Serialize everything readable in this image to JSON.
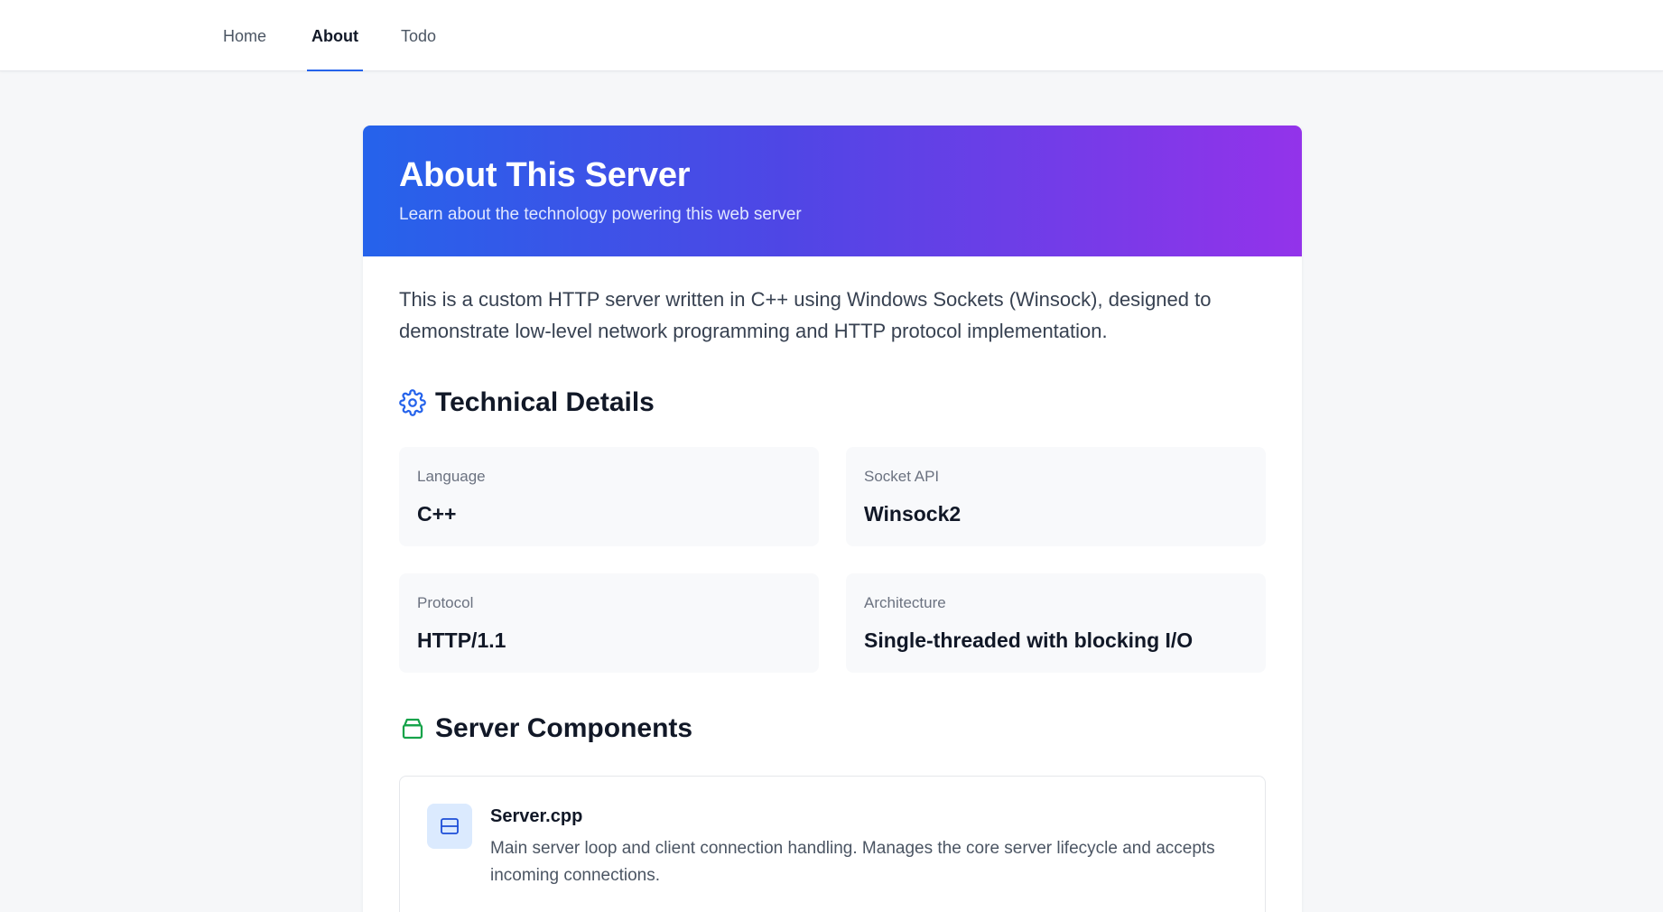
{
  "nav": {
    "home": "Home",
    "about": "About",
    "todo": "Todo"
  },
  "hero": {
    "title": "About This Server",
    "subtitle": "Learn about the technology powering this web server"
  },
  "intro": "This is a custom HTTP server written in C++ using Windows Sockets (Winsock), designed to demonstrate low-level network programming and HTTP protocol implementation.",
  "technical": {
    "heading": "Technical Details",
    "icon": "gear-icon",
    "items": [
      {
        "label": "Language",
        "value": "C++"
      },
      {
        "label": "Socket API",
        "value": "Winsock2"
      },
      {
        "label": "Protocol",
        "value": "HTTP/1.1"
      },
      {
        "label": "Architecture",
        "value": "Single-threaded with blocking I/O"
      }
    ]
  },
  "components": {
    "heading": "Server Components",
    "icon": "box-icon",
    "items": [
      {
        "name": "Server.cpp",
        "description": "Main server loop and client connection handling. Manages the core server lifecycle and accepts incoming connections.",
        "icon": "server-icon"
      }
    ]
  },
  "colors": {
    "accent": "#2563eb",
    "gradient_start": "#2563eb",
    "gradient_end": "#9333ea",
    "components_icon": "#16a34a",
    "server_icon_bg": "#dbeafe"
  }
}
